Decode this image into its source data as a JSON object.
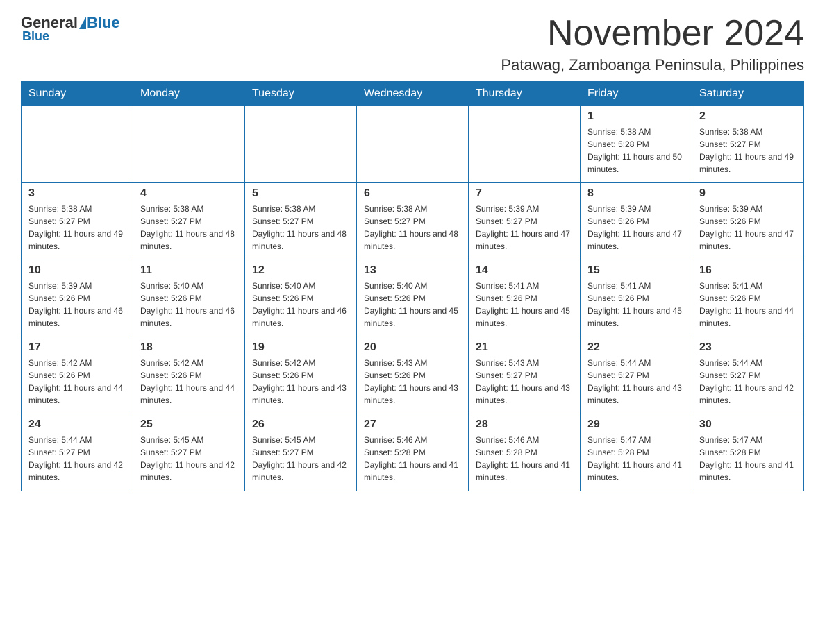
{
  "logo": {
    "general": "General",
    "blue": "Blue"
  },
  "header": {
    "month": "November 2024",
    "location": "Patawag, Zamboanga Peninsula, Philippines"
  },
  "weekdays": [
    "Sunday",
    "Monday",
    "Tuesday",
    "Wednesday",
    "Thursday",
    "Friday",
    "Saturday"
  ],
  "weeks": [
    [
      {
        "day": "",
        "info": ""
      },
      {
        "day": "",
        "info": ""
      },
      {
        "day": "",
        "info": ""
      },
      {
        "day": "",
        "info": ""
      },
      {
        "day": "",
        "info": ""
      },
      {
        "day": "1",
        "info": "Sunrise: 5:38 AM\nSunset: 5:28 PM\nDaylight: 11 hours and 50 minutes."
      },
      {
        "day": "2",
        "info": "Sunrise: 5:38 AM\nSunset: 5:27 PM\nDaylight: 11 hours and 49 minutes."
      }
    ],
    [
      {
        "day": "3",
        "info": "Sunrise: 5:38 AM\nSunset: 5:27 PM\nDaylight: 11 hours and 49 minutes."
      },
      {
        "day": "4",
        "info": "Sunrise: 5:38 AM\nSunset: 5:27 PM\nDaylight: 11 hours and 48 minutes."
      },
      {
        "day": "5",
        "info": "Sunrise: 5:38 AM\nSunset: 5:27 PM\nDaylight: 11 hours and 48 minutes."
      },
      {
        "day": "6",
        "info": "Sunrise: 5:38 AM\nSunset: 5:27 PM\nDaylight: 11 hours and 48 minutes."
      },
      {
        "day": "7",
        "info": "Sunrise: 5:39 AM\nSunset: 5:27 PM\nDaylight: 11 hours and 47 minutes."
      },
      {
        "day": "8",
        "info": "Sunrise: 5:39 AM\nSunset: 5:26 PM\nDaylight: 11 hours and 47 minutes."
      },
      {
        "day": "9",
        "info": "Sunrise: 5:39 AM\nSunset: 5:26 PM\nDaylight: 11 hours and 47 minutes."
      }
    ],
    [
      {
        "day": "10",
        "info": "Sunrise: 5:39 AM\nSunset: 5:26 PM\nDaylight: 11 hours and 46 minutes."
      },
      {
        "day": "11",
        "info": "Sunrise: 5:40 AM\nSunset: 5:26 PM\nDaylight: 11 hours and 46 minutes."
      },
      {
        "day": "12",
        "info": "Sunrise: 5:40 AM\nSunset: 5:26 PM\nDaylight: 11 hours and 46 minutes."
      },
      {
        "day": "13",
        "info": "Sunrise: 5:40 AM\nSunset: 5:26 PM\nDaylight: 11 hours and 45 minutes."
      },
      {
        "day": "14",
        "info": "Sunrise: 5:41 AM\nSunset: 5:26 PM\nDaylight: 11 hours and 45 minutes."
      },
      {
        "day": "15",
        "info": "Sunrise: 5:41 AM\nSunset: 5:26 PM\nDaylight: 11 hours and 45 minutes."
      },
      {
        "day": "16",
        "info": "Sunrise: 5:41 AM\nSunset: 5:26 PM\nDaylight: 11 hours and 44 minutes."
      }
    ],
    [
      {
        "day": "17",
        "info": "Sunrise: 5:42 AM\nSunset: 5:26 PM\nDaylight: 11 hours and 44 minutes."
      },
      {
        "day": "18",
        "info": "Sunrise: 5:42 AM\nSunset: 5:26 PM\nDaylight: 11 hours and 44 minutes."
      },
      {
        "day": "19",
        "info": "Sunrise: 5:42 AM\nSunset: 5:26 PM\nDaylight: 11 hours and 43 minutes."
      },
      {
        "day": "20",
        "info": "Sunrise: 5:43 AM\nSunset: 5:26 PM\nDaylight: 11 hours and 43 minutes."
      },
      {
        "day": "21",
        "info": "Sunrise: 5:43 AM\nSunset: 5:27 PM\nDaylight: 11 hours and 43 minutes."
      },
      {
        "day": "22",
        "info": "Sunrise: 5:44 AM\nSunset: 5:27 PM\nDaylight: 11 hours and 43 minutes."
      },
      {
        "day": "23",
        "info": "Sunrise: 5:44 AM\nSunset: 5:27 PM\nDaylight: 11 hours and 42 minutes."
      }
    ],
    [
      {
        "day": "24",
        "info": "Sunrise: 5:44 AM\nSunset: 5:27 PM\nDaylight: 11 hours and 42 minutes."
      },
      {
        "day": "25",
        "info": "Sunrise: 5:45 AM\nSunset: 5:27 PM\nDaylight: 11 hours and 42 minutes."
      },
      {
        "day": "26",
        "info": "Sunrise: 5:45 AM\nSunset: 5:27 PM\nDaylight: 11 hours and 42 minutes."
      },
      {
        "day": "27",
        "info": "Sunrise: 5:46 AM\nSunset: 5:28 PM\nDaylight: 11 hours and 41 minutes."
      },
      {
        "day": "28",
        "info": "Sunrise: 5:46 AM\nSunset: 5:28 PM\nDaylight: 11 hours and 41 minutes."
      },
      {
        "day": "29",
        "info": "Sunrise: 5:47 AM\nSunset: 5:28 PM\nDaylight: 11 hours and 41 minutes."
      },
      {
        "day": "30",
        "info": "Sunrise: 5:47 AM\nSunset: 5:28 PM\nDaylight: 11 hours and 41 minutes."
      }
    ]
  ]
}
